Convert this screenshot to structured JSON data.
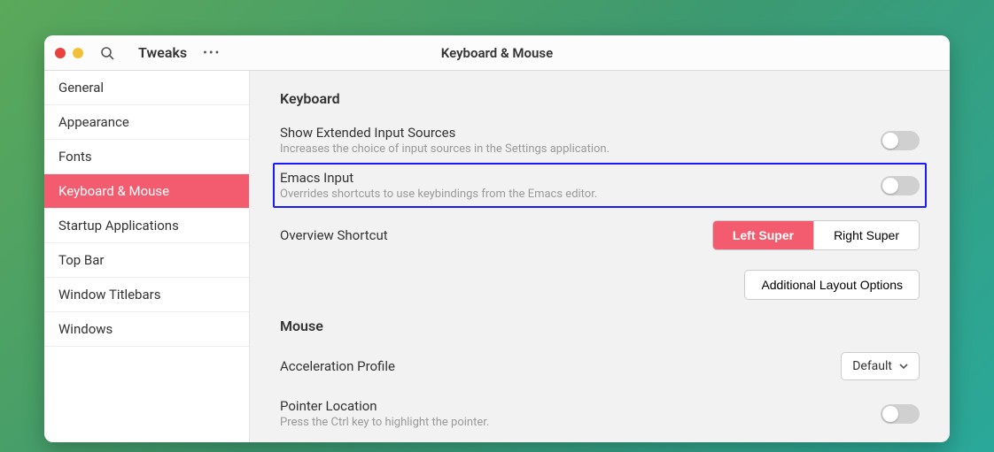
{
  "colors": {
    "accent": "#f25c6e",
    "highlight_border": "#1a1aff"
  },
  "header": {
    "app_title": "Tweaks",
    "page_title": "Keyboard & Mouse"
  },
  "sidebar": {
    "items": [
      {
        "label": "General"
      },
      {
        "label": "Appearance"
      },
      {
        "label": "Fonts"
      },
      {
        "label": "Keyboard & Mouse"
      },
      {
        "label": "Startup Applications"
      },
      {
        "label": "Top Bar"
      },
      {
        "label": "Window Titlebars"
      },
      {
        "label": "Windows"
      }
    ],
    "selected_index": 3
  },
  "content": {
    "keyboard": {
      "section_title": "Keyboard",
      "extended_sources": {
        "title": "Show Extended Input Sources",
        "desc": "Increases the choice of input sources in the Settings application.",
        "value": false
      },
      "emacs": {
        "title": "Emacs Input",
        "desc": "Overrides shortcuts to use keybindings from the Emacs editor.",
        "value": false,
        "highlighted": true
      },
      "overview": {
        "title": "Overview Shortcut",
        "options": {
          "left": "Left Super",
          "right": "Right Super"
        },
        "selected": "left"
      },
      "additional_button": "Additional Layout Options"
    },
    "mouse": {
      "section_title": "Mouse",
      "accel": {
        "title": "Acceleration Profile",
        "selected": "Default"
      },
      "pointer_loc": {
        "title": "Pointer Location",
        "desc": "Press the Ctrl key to highlight the pointer.",
        "value": false
      }
    }
  }
}
